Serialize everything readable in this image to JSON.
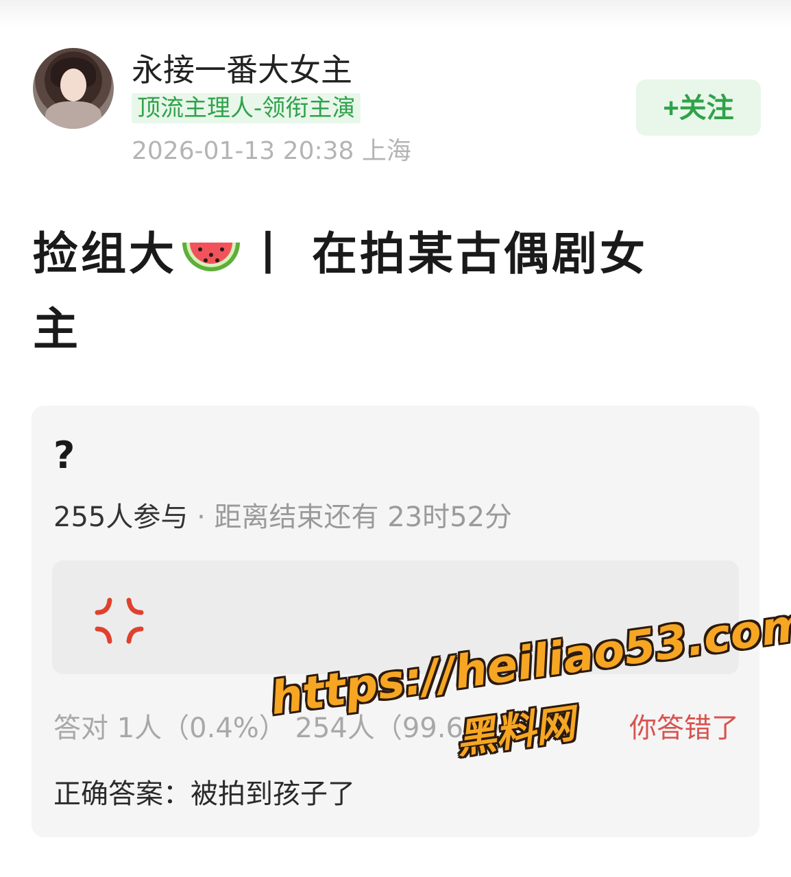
{
  "user": {
    "name": "永接一番大女主",
    "tag": "顶流主理人-领衔主演",
    "date": "2026-01-13 20:38",
    "location": "上海",
    "follow_label": "+关注"
  },
  "post": {
    "title_part1": "捡组大",
    "title_emoji": "watermelon-emoji",
    "title_part2": "丨 在拍某古偶剧女",
    "title_part3": "主"
  },
  "quiz": {
    "question": "?",
    "participants": "255人参与",
    "separator": "·",
    "countdown": "距离结束还有 23时52分",
    "option_icon": "anger-symbol-icon",
    "result_summary": "答对 1人（0.4%） 254人（99.6%）",
    "your_result": "你答错了",
    "correct_answer": "正确答案：被拍到孩子了"
  },
  "watermark": {
    "url": "https://heiliao53.com",
    "brand": "黑料网"
  },
  "colors": {
    "accent_green": "#2fa24a",
    "tag_bg": "#e8f7ea",
    "wrong_red": "#d9534f",
    "watermark_orange": "#f6a623"
  }
}
